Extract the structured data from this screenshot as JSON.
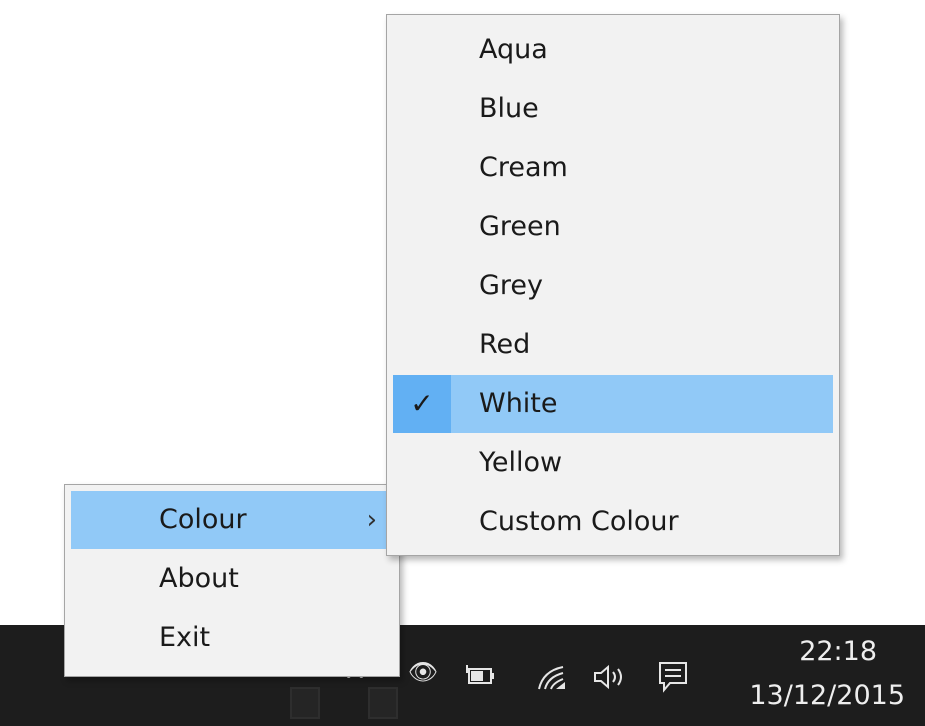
{
  "context_menu": {
    "items": [
      {
        "label": "Colour",
        "has_submenu": true,
        "highlighted": true
      },
      {
        "label": "About"
      },
      {
        "label": "Exit"
      }
    ],
    "submenu_arrow": "›"
  },
  "colour_submenu": {
    "items": [
      {
        "label": "Aqua"
      },
      {
        "label": "Blue"
      },
      {
        "label": "Cream"
      },
      {
        "label": "Green"
      },
      {
        "label": "Grey"
      },
      {
        "label": "Red"
      },
      {
        "label": "White",
        "checked": true,
        "highlighted": true
      },
      {
        "label": "Yellow"
      },
      {
        "label": "Custom Colour"
      }
    ],
    "check_mark": "✓"
  },
  "taskbar": {
    "tray_icons": [
      {
        "name": "chevron-up-icon",
        "glyph": "^"
      },
      {
        "name": "eye-icon",
        "glyph": "👁"
      },
      {
        "name": "battery-power-icon",
        "glyph": "🔌"
      },
      {
        "name": "wifi-icon",
        "glyph": "◢"
      },
      {
        "name": "volume-icon",
        "glyph": "🔈"
      },
      {
        "name": "action-center-icon",
        "glyph": "▤"
      }
    ],
    "clock": {
      "time": "22:18",
      "date": "13/12/2015"
    }
  },
  "colors": {
    "menu_background": "#f2f2f2",
    "highlight": "#91c9f7",
    "check_highlight": "#62b0f3",
    "taskbar": "#1d1d1d"
  }
}
